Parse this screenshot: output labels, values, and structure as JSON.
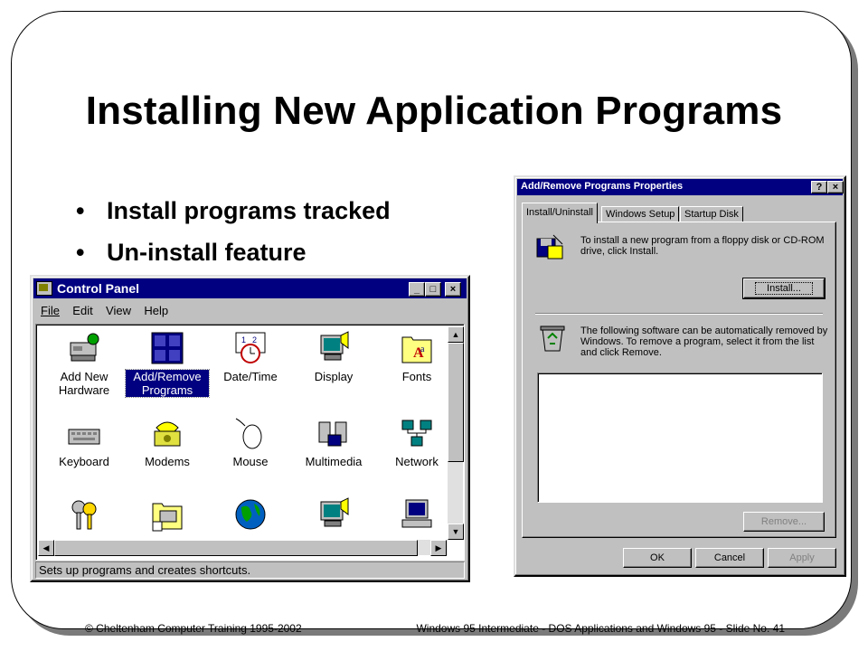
{
  "slide": {
    "title": "Installing New Application Programs",
    "bullets": [
      "Install programs tracked",
      "Un-install feature"
    ],
    "footer_left": "© Cheltenham Computer Training 1995-2002",
    "footer_right": "Windows 95 Intermediate - DOS Applications and Windows 95 - Slide No. 41"
  },
  "control_panel": {
    "title": "Control Panel",
    "menu": [
      "File",
      "Edit",
      "View",
      "Help"
    ],
    "icons": [
      {
        "label": "Add New\nHardware",
        "icon": "add-hardware-icon"
      },
      {
        "label": "Add/Remove\nPrograms",
        "icon": "add-remove-programs-icon",
        "selected": true
      },
      {
        "label": "Date/Time",
        "icon": "date-time-icon"
      },
      {
        "label": "Display",
        "icon": "display-icon"
      },
      {
        "label": "Fonts",
        "icon": "fonts-icon"
      },
      {
        "label": "Keyboard",
        "icon": "keyboard-icon"
      },
      {
        "label": "Modems",
        "icon": "modem-icon"
      },
      {
        "label": "Mouse",
        "icon": "mouse-icon"
      },
      {
        "label": "Multimedia",
        "icon": "multimedia-icon"
      },
      {
        "label": "Network",
        "icon": "network-icon"
      },
      {
        "label": "",
        "icon": "passwords-icon"
      },
      {
        "label": "",
        "icon": "printers-icon"
      },
      {
        "label": "",
        "icon": "regional-settings-icon"
      },
      {
        "label": "",
        "icon": "sounds-icon"
      },
      {
        "label": "",
        "icon": "system-icon"
      }
    ],
    "status": "Sets up programs and creates shortcuts."
  },
  "dialog": {
    "title": "Add/Remove Programs Properties",
    "tabs": [
      "Install/Uninstall",
      "Windows Setup",
      "Startup Disk"
    ],
    "install_text": "To install a new program from a floppy disk or CD-ROM drive, click Install.",
    "install_button": "Install...",
    "remove_text": "The following software can be automatically removed by Windows. To remove a program, select it from the list and click Remove.",
    "remove_button": "Remove...",
    "ok_button": "OK",
    "cancel_button": "Cancel",
    "apply_button": "Apply"
  }
}
